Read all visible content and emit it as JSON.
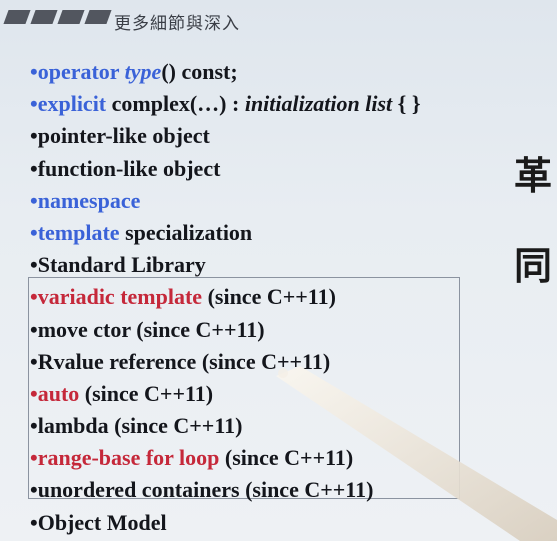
{
  "header": {
    "title": "更多細節與深入"
  },
  "bullets": [
    {
      "bullet": "•",
      "keyword": "operator",
      "keyword2": "type",
      "rest": "() const;"
    },
    {
      "bullet": "•",
      "keyword": "explicit",
      "rest": " complex(…) : ",
      "italic": "initialization list",
      "tail": " { }"
    },
    {
      "bullet": "•",
      "text": "pointer-like object"
    },
    {
      "bullet": "•",
      "text": "function-like object"
    },
    {
      "bullet": "•",
      "keyword": "namespace"
    },
    {
      "bullet": "•",
      "keyword": "template",
      "rest": " specialization"
    },
    {
      "bullet": "•",
      "text": "Standard Library"
    },
    {
      "bullet": "•",
      "keyword": "variadic template",
      "rest": " (since C++11)"
    },
    {
      "bullet": "•",
      "text": "move ctor (since C++11)"
    },
    {
      "bullet": "•",
      "text": "Rvalue reference (since C++11)"
    },
    {
      "bullet": "•",
      "keyword": "auto",
      "rest": " (since C++11)"
    },
    {
      "bullet": "•",
      "text": "lambda (since C++11)"
    },
    {
      "bullet": "•",
      "keyword": "range-base for loop",
      "rest": " (since C++11)"
    },
    {
      "bullet": "•",
      "text": "unordered containers (since C++11)"
    },
    {
      "bullet": "•",
      "text": "Object Model"
    }
  ],
  "side_text": [
    "革",
    "同"
  ],
  "colors": {
    "blue_keyword": "#3a62d8",
    "red_keyword": "#c5283a",
    "text": "#14161c",
    "background": "#e8edf2"
  }
}
